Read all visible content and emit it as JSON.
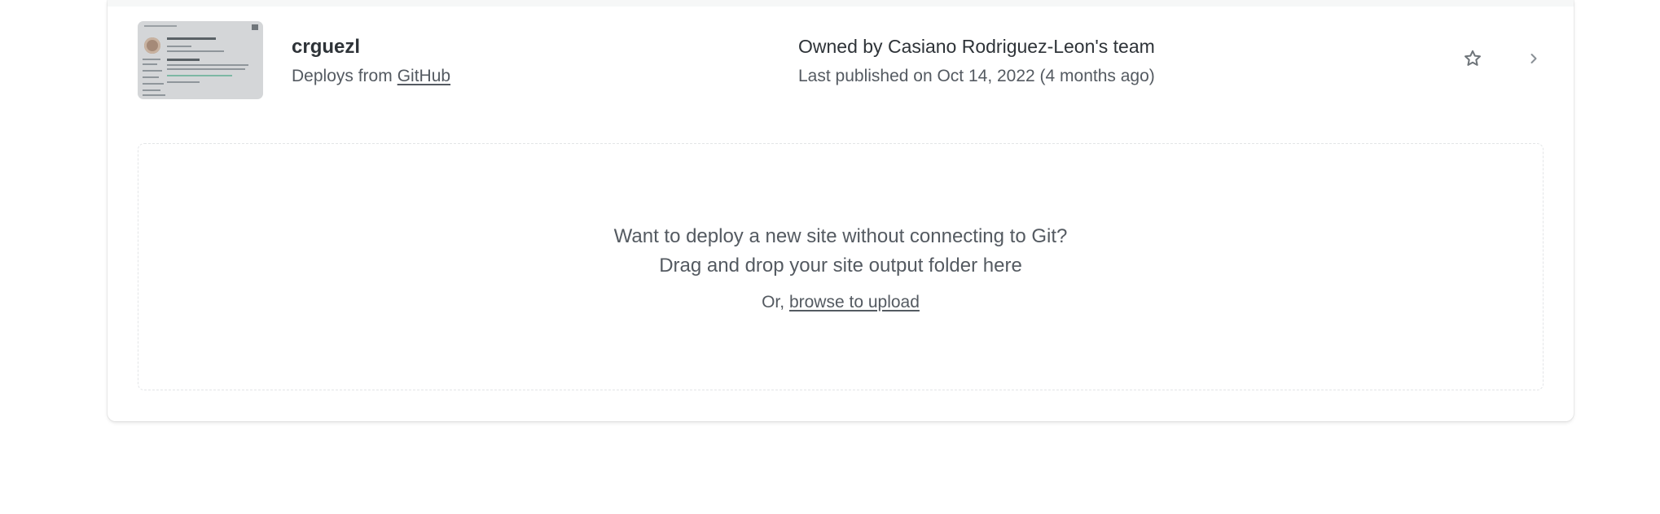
{
  "site": {
    "name": "crguezl",
    "deploys_prefix": "Deploys from",
    "deploys_source": "GitHub",
    "owner_prefix": "Owned by",
    "owner_team": "Casiano Rodriguez-Leon's team",
    "published": "Last published on Oct 14, 2022 (4 months ago)"
  },
  "dropzone": {
    "line1": "Want to deploy a new site without connecting to Git?",
    "line2": "Drag and drop your site output folder here",
    "or_prefix": "Or,",
    "browse_link": "browse to upload"
  },
  "icons": {
    "favorite": "star-icon",
    "open": "chevron-right-icon"
  },
  "colors": {
    "text_primary": "#2e3338",
    "text_secondary": "#545a61",
    "icon": "#6f757a"
  }
}
